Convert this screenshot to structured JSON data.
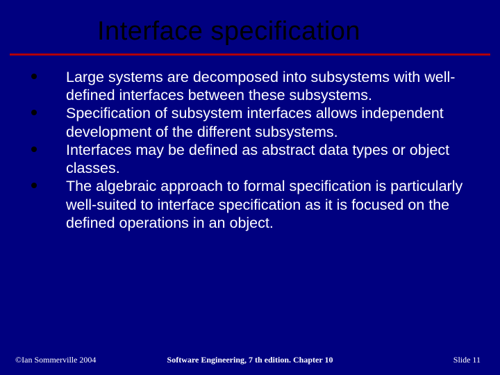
{
  "slide": {
    "title": "Interface specification",
    "bullets": [
      "Large systems are decomposed into subsystems with well-defined interfaces between these subsystems.",
      "Specification of subsystem interfaces allows independent development of the different subsystems.",
      "Interfaces may be defined as abstract data types or object classes.",
      "The algebraic approach to formal specification is particularly well-suited to interface specification as it is focused on the defined operations in an object."
    ],
    "footer": {
      "left": "©Ian Sommerville 2004",
      "center": "Software Engineering, 7 th edition. Chapter 10",
      "right": "Slide  11"
    }
  }
}
